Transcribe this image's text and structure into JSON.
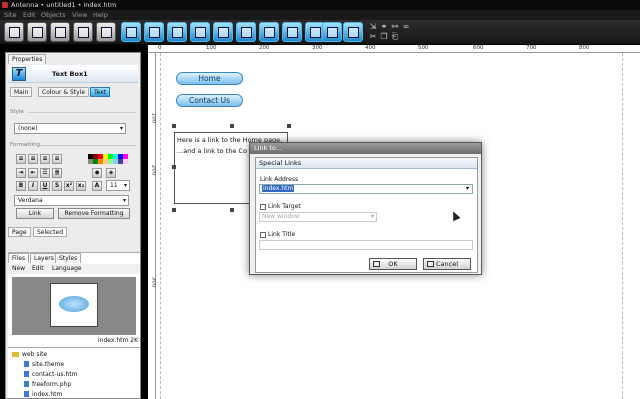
{
  "window": {
    "title": "Antenna • untitled1 • index.htm"
  },
  "menu": [
    "Site",
    "Edit",
    "Objects",
    "View",
    "Help"
  ],
  "left_panel": {
    "tabs": [
      "Properties"
    ],
    "object_name": "Text Box1",
    "sub_tabs": [
      "Main",
      "Colour & Style",
      "Text"
    ],
    "style_label": "Style",
    "style_value": "(none)",
    "formatting_label": "Formatting",
    "font_size": "11",
    "font_family": "Verdana",
    "link_button": "Link",
    "remove_formatting_button": "Remove Formatting",
    "page_tabs": [
      "Page",
      "Selected"
    ]
  },
  "files_panel": {
    "tabs": [
      "Files",
      "Layers",
      "Styles"
    ],
    "toolbar": [
      "New",
      "Edit",
      "Language"
    ],
    "preview_caption": "index.htm 2K",
    "tree": {
      "root": "web site",
      "items": [
        "site.theme",
        "contact-us.htm",
        "freeform.php",
        "index.htm"
      ]
    }
  },
  "ruler": {
    "h_ticks": [
      "0",
      "100",
      "200",
      "300",
      "400",
      "500",
      "600",
      "700",
      "800"
    ],
    "v_ticks": [
      "100",
      "200",
      "300"
    ]
  },
  "canvas": {
    "nav_buttons": [
      "Home",
      "Contact Us"
    ],
    "text_lines": [
      "Here is a link to the Home page.",
      "...and a link to the Co"
    ]
  },
  "dialog": {
    "title": "Link to...",
    "tab": "Special Links",
    "link_address_label": "Link Address",
    "link_address_value": "index.htm",
    "link_target_label": "Link Target",
    "link_target_placeholder": "New window",
    "link_title_label": "Link Title",
    "link_title_value": "",
    "ok_label": "OK",
    "cancel_label": "Cancel"
  },
  "colors": {
    "accent": "#39a7e3",
    "selection": "#3168c6"
  }
}
